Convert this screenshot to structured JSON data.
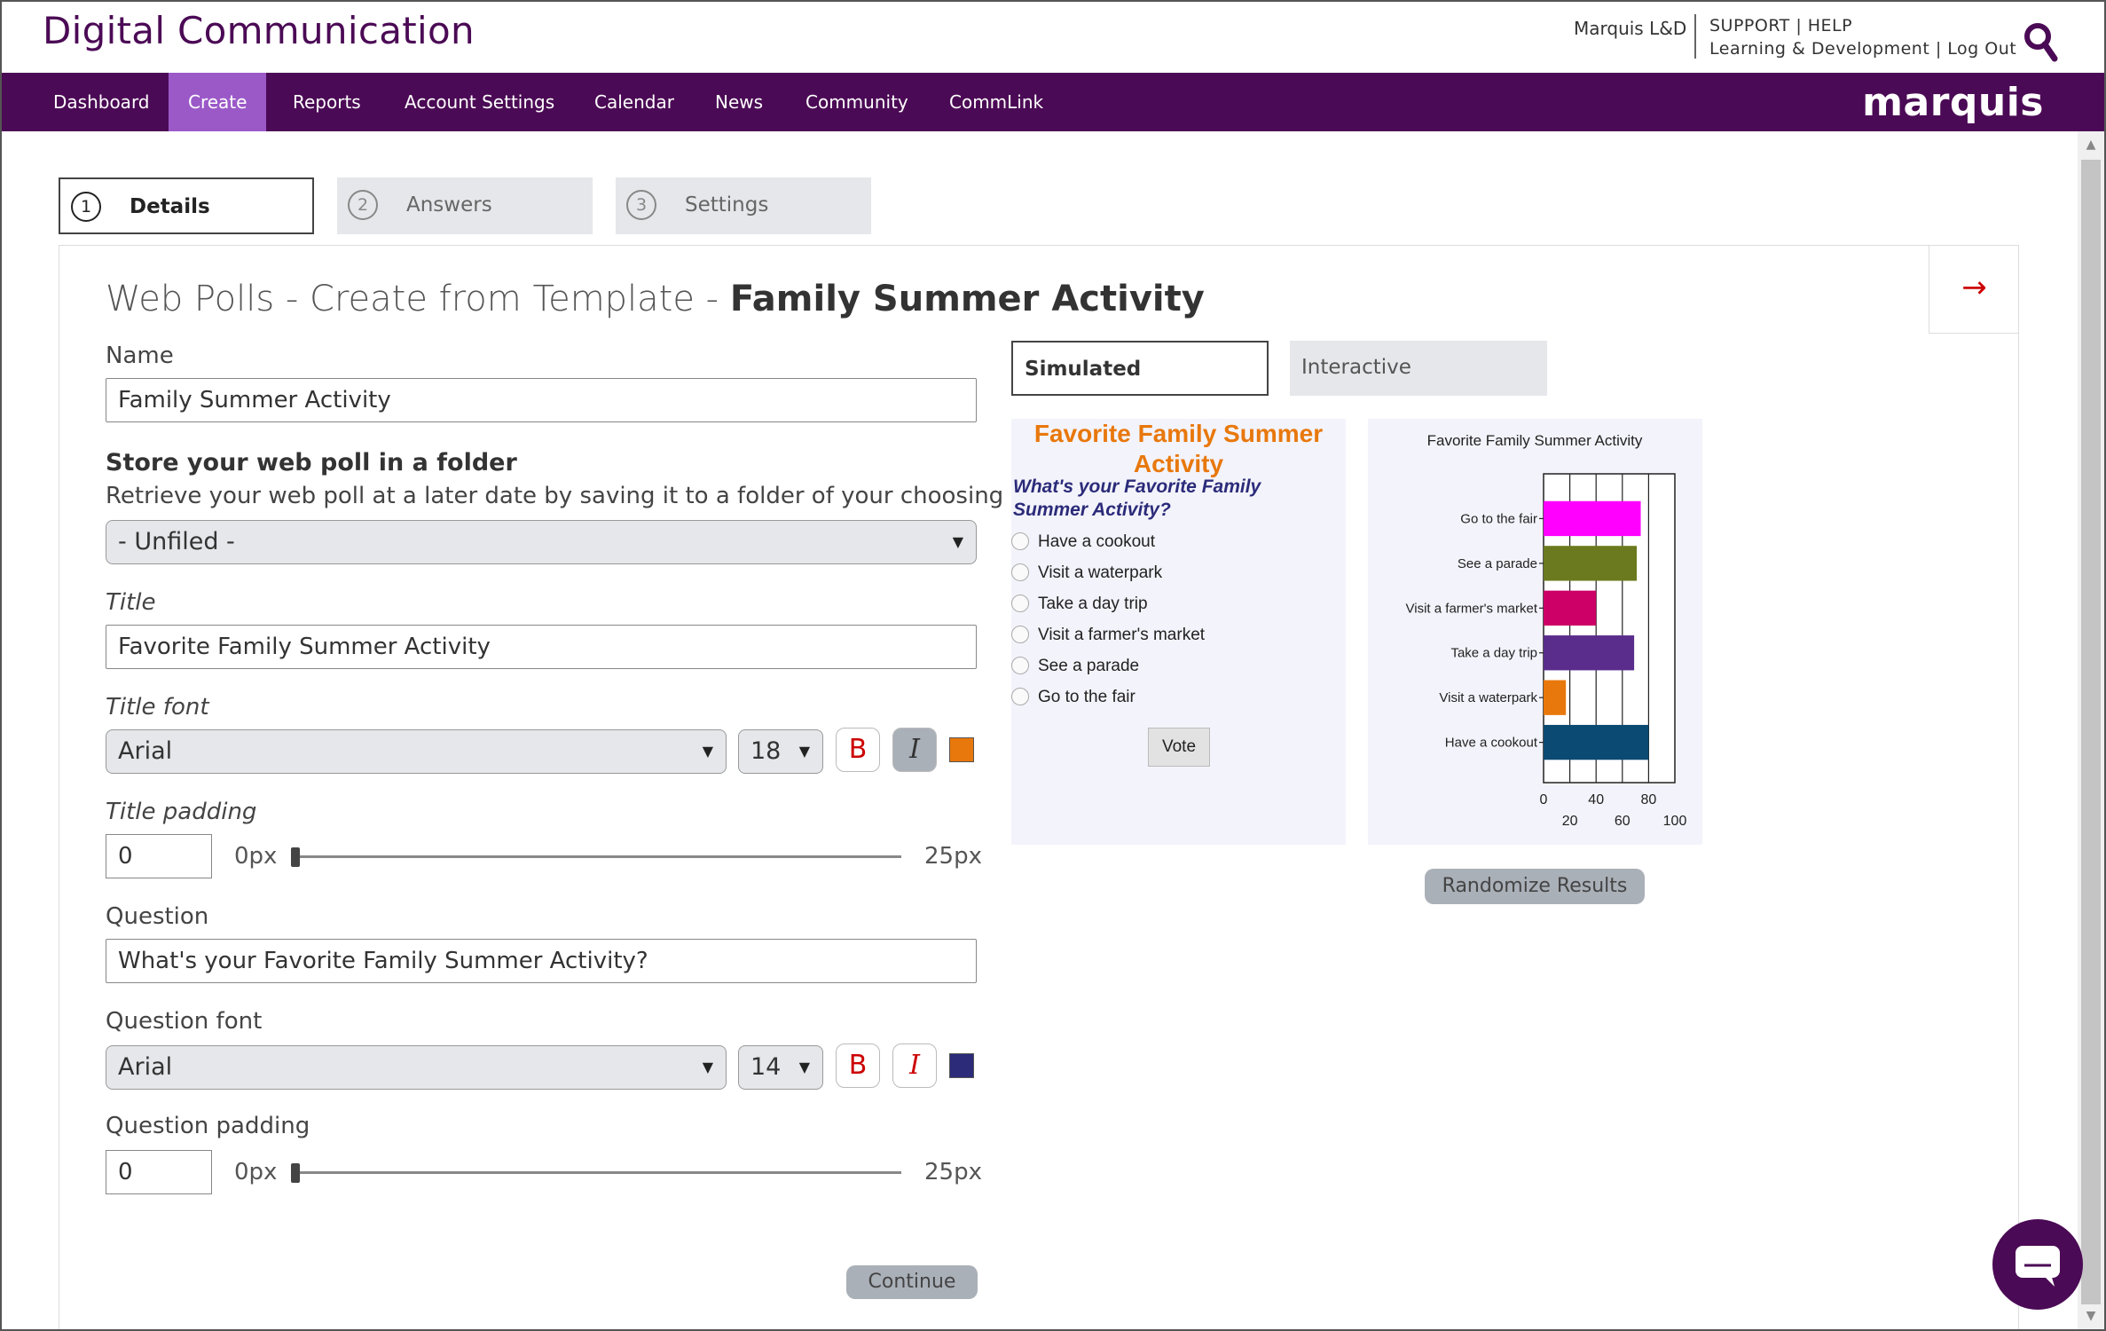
{
  "header": {
    "app_title": "Digital Communication",
    "account_name": "Marquis L&D",
    "support_label": "SUPPORT",
    "help_label": "HELP",
    "org_name": "Learning & Development",
    "logout_label": "Log Out",
    "logo_text": "marquis"
  },
  "nav": {
    "items": [
      {
        "label": "Dashboard",
        "active": false
      },
      {
        "label": "Create",
        "active": true
      },
      {
        "label": "Reports",
        "active": false
      },
      {
        "label": "Account Settings",
        "active": false
      },
      {
        "label": "Calendar",
        "active": false
      },
      {
        "label": "News",
        "active": false
      },
      {
        "label": "Community",
        "active": false
      },
      {
        "label": "CommLink",
        "active": false
      }
    ]
  },
  "steps": [
    {
      "num": "1",
      "label": "Details",
      "active": true
    },
    {
      "num": "2",
      "label": "Answers",
      "active": false
    },
    {
      "num": "3",
      "label": "Settings",
      "active": false
    }
  ],
  "page": {
    "title_prefix": "Web Polls - Create from Template - ",
    "title_name": "Family Summer Activity"
  },
  "form": {
    "name_label": "Name",
    "name_value": "Family Summer Activity",
    "folder_heading": "Store your web poll in a folder",
    "folder_desc": "Retrieve your web poll at a later date by saving it to a folder of your choosing",
    "folder_value": "- Unfiled -",
    "title_label": "Title",
    "title_value": "Favorite Family Summer Activity",
    "title_font_label": "Title font",
    "title_font_value": "Arial",
    "title_size_value": "18",
    "title_bold_label": "B",
    "title_italic_label": "I",
    "title_color": "#e8780c",
    "title_padding_label": "Title padding",
    "title_padding_value": "0",
    "question_label": "Question",
    "question_value": "What's your Favorite Family Summer Activity?",
    "question_font_label": "Question font",
    "question_font_value": "Arial",
    "question_size_value": "14",
    "question_bold_label": "B",
    "question_italic_label": "I",
    "question_color": "#2b2b7a",
    "question_padding_label": "Question padding",
    "question_padding_value": "0",
    "slider_min_label": "0px",
    "slider_max_label": "25px",
    "title_padding_level": 0,
    "question_padding_level": 0,
    "continue_label": "Continue"
  },
  "preview": {
    "tabs": [
      {
        "label": "Simulated",
        "active": true
      },
      {
        "label": "Interactive",
        "active": false
      }
    ],
    "poll_title": "Favorite Family Summer Activity",
    "poll_question": "What's your Favorite Family Summer Activity?",
    "options": [
      "Have a cookout",
      "Visit a waterpark",
      "Take a day trip",
      "Visit a farmer's market",
      "See a parade",
      "Go to the fair"
    ],
    "vote_label": "Vote",
    "randomize_label": "Randomize Results"
  },
  "chart_data": {
    "type": "bar",
    "orientation": "horizontal",
    "title": "Favorite Family Summer Activity",
    "categories": [
      "Go to the fair",
      "See a parade",
      "Visit a farmer's market",
      "Take a day trip",
      "Visit a waterpark",
      "Have a cookout"
    ],
    "values": [
      74,
      71,
      40,
      69,
      17,
      80
    ],
    "colors": [
      "#ff00ff",
      "#6b7a1e",
      "#cc0066",
      "#5a2d8c",
      "#e8780c",
      "#0b4a73"
    ],
    "xlim": [
      0,
      100
    ],
    "xticks_top": [
      "0",
      "40",
      "80"
    ],
    "xticks_bottom": [
      "20",
      "60",
      "100"
    ],
    "grid": true
  },
  "colors": {
    "brand_purple": "#4b0a55",
    "nav_active": "#9b59c8",
    "accent_red": "#cc0000"
  },
  "icons": {
    "search": "search-icon",
    "next": "arrow-right-icon",
    "chat": "chat-bubble-icon"
  }
}
